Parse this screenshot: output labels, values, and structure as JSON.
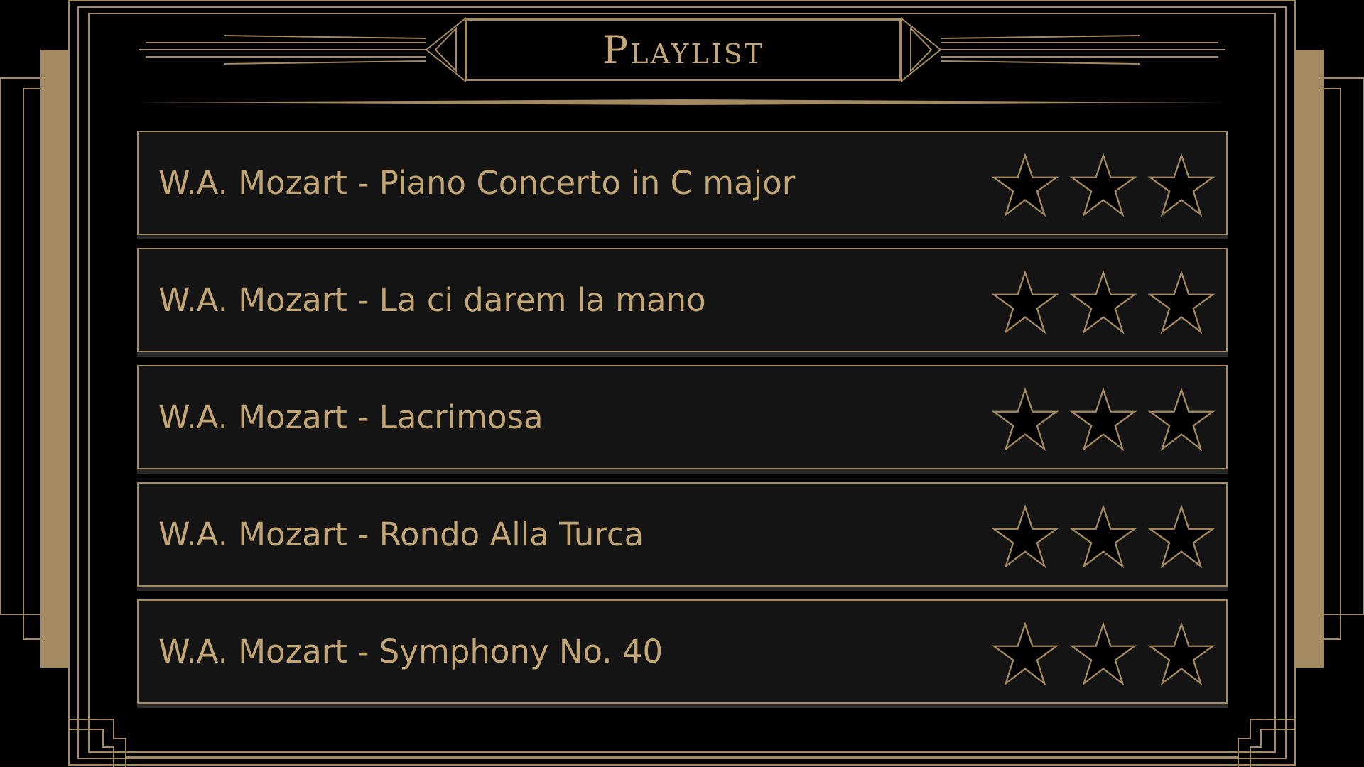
{
  "header": {
    "title": "Playlist"
  },
  "playlist": {
    "items": [
      {
        "label": "W.A. Mozart - Piano Concerto in C major",
        "rating": 0,
        "max_rating": 3
      },
      {
        "label": "W.A. Mozart - La ci darem la mano",
        "rating": 0,
        "max_rating": 3
      },
      {
        "label": "W.A. Mozart - Lacrimosa",
        "rating": 0,
        "max_rating": 3
      },
      {
        "label": "W.A. Mozart - Rondo Alla Turca",
        "rating": 0,
        "max_rating": 3
      },
      {
        "label": "W.A. Mozart - Symphony No. 40",
        "rating": 0,
        "max_rating": 3
      }
    ]
  },
  "colors": {
    "gold": "#a48a60",
    "text_gold": "#c3a675",
    "row_bg": "#141414",
    "background": "#000000"
  },
  "icons": {
    "rating": "star-icon"
  }
}
